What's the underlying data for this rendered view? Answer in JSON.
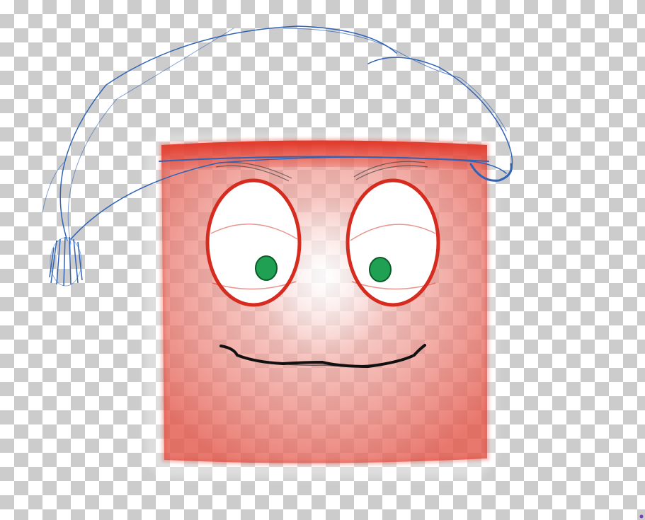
{
  "image": {
    "subject": "cartoon-square-face-with-nightcap",
    "background": "transparency-checkerboard",
    "colors": {
      "checker_light": "#ffffff",
      "checker_dark": "#cccccc",
      "face_fill": "#e8574b",
      "face_edge": "#d9372a",
      "eye_white": "#ffffff",
      "eye_outline": "#d62b1f",
      "pupil": "#1fa052",
      "mouth": "#111111",
      "hat_line": "#2f63b5",
      "eyebrow": "#444444"
    },
    "icons": [
      "nightcap-icon",
      "face-square",
      "left-eye",
      "right-eye",
      "mouth-icon",
      "pom-pom-icon"
    ]
  }
}
